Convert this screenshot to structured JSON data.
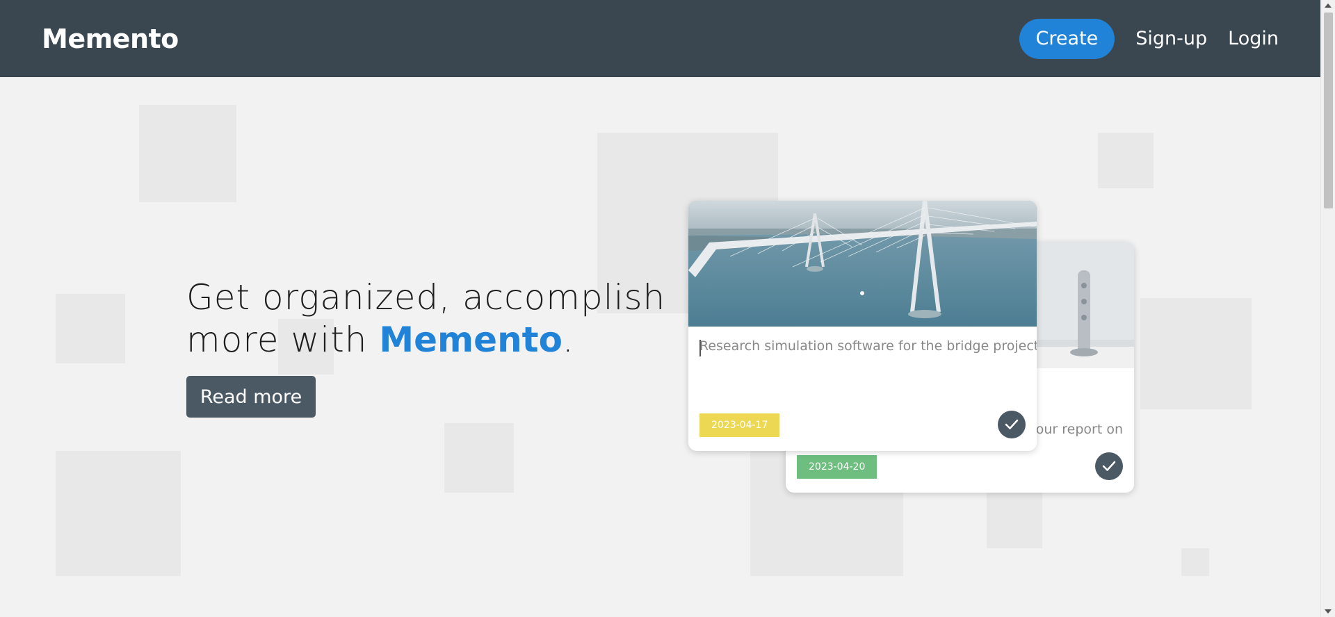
{
  "header": {
    "brand": "Memento",
    "create_label": "Create",
    "signup_label": "Sign-up",
    "login_label": "Login"
  },
  "hero": {
    "title_line1": "Get organized, accomplish",
    "title_line2_prefix": "more with ",
    "title_brand": "Memento",
    "title_suffix": ".",
    "read_more_label": "Read more"
  },
  "cards": [
    {
      "image": "bridge-photo",
      "text": "Research simulation software for the bridge project.",
      "date": "2023-04-17",
      "date_color": "#ecd853",
      "done_icon": "check-icon"
    },
    {
      "image": "device-photo",
      "text": "our report on",
      "date": "2023-04-20",
      "date_color": "#6dbe7f",
      "done_icon": "check-icon"
    }
  ],
  "colors": {
    "navbar": "#3a4650",
    "accent": "#2083d8",
    "button_dark": "#4b5965",
    "background": "#f2f2f2"
  }
}
